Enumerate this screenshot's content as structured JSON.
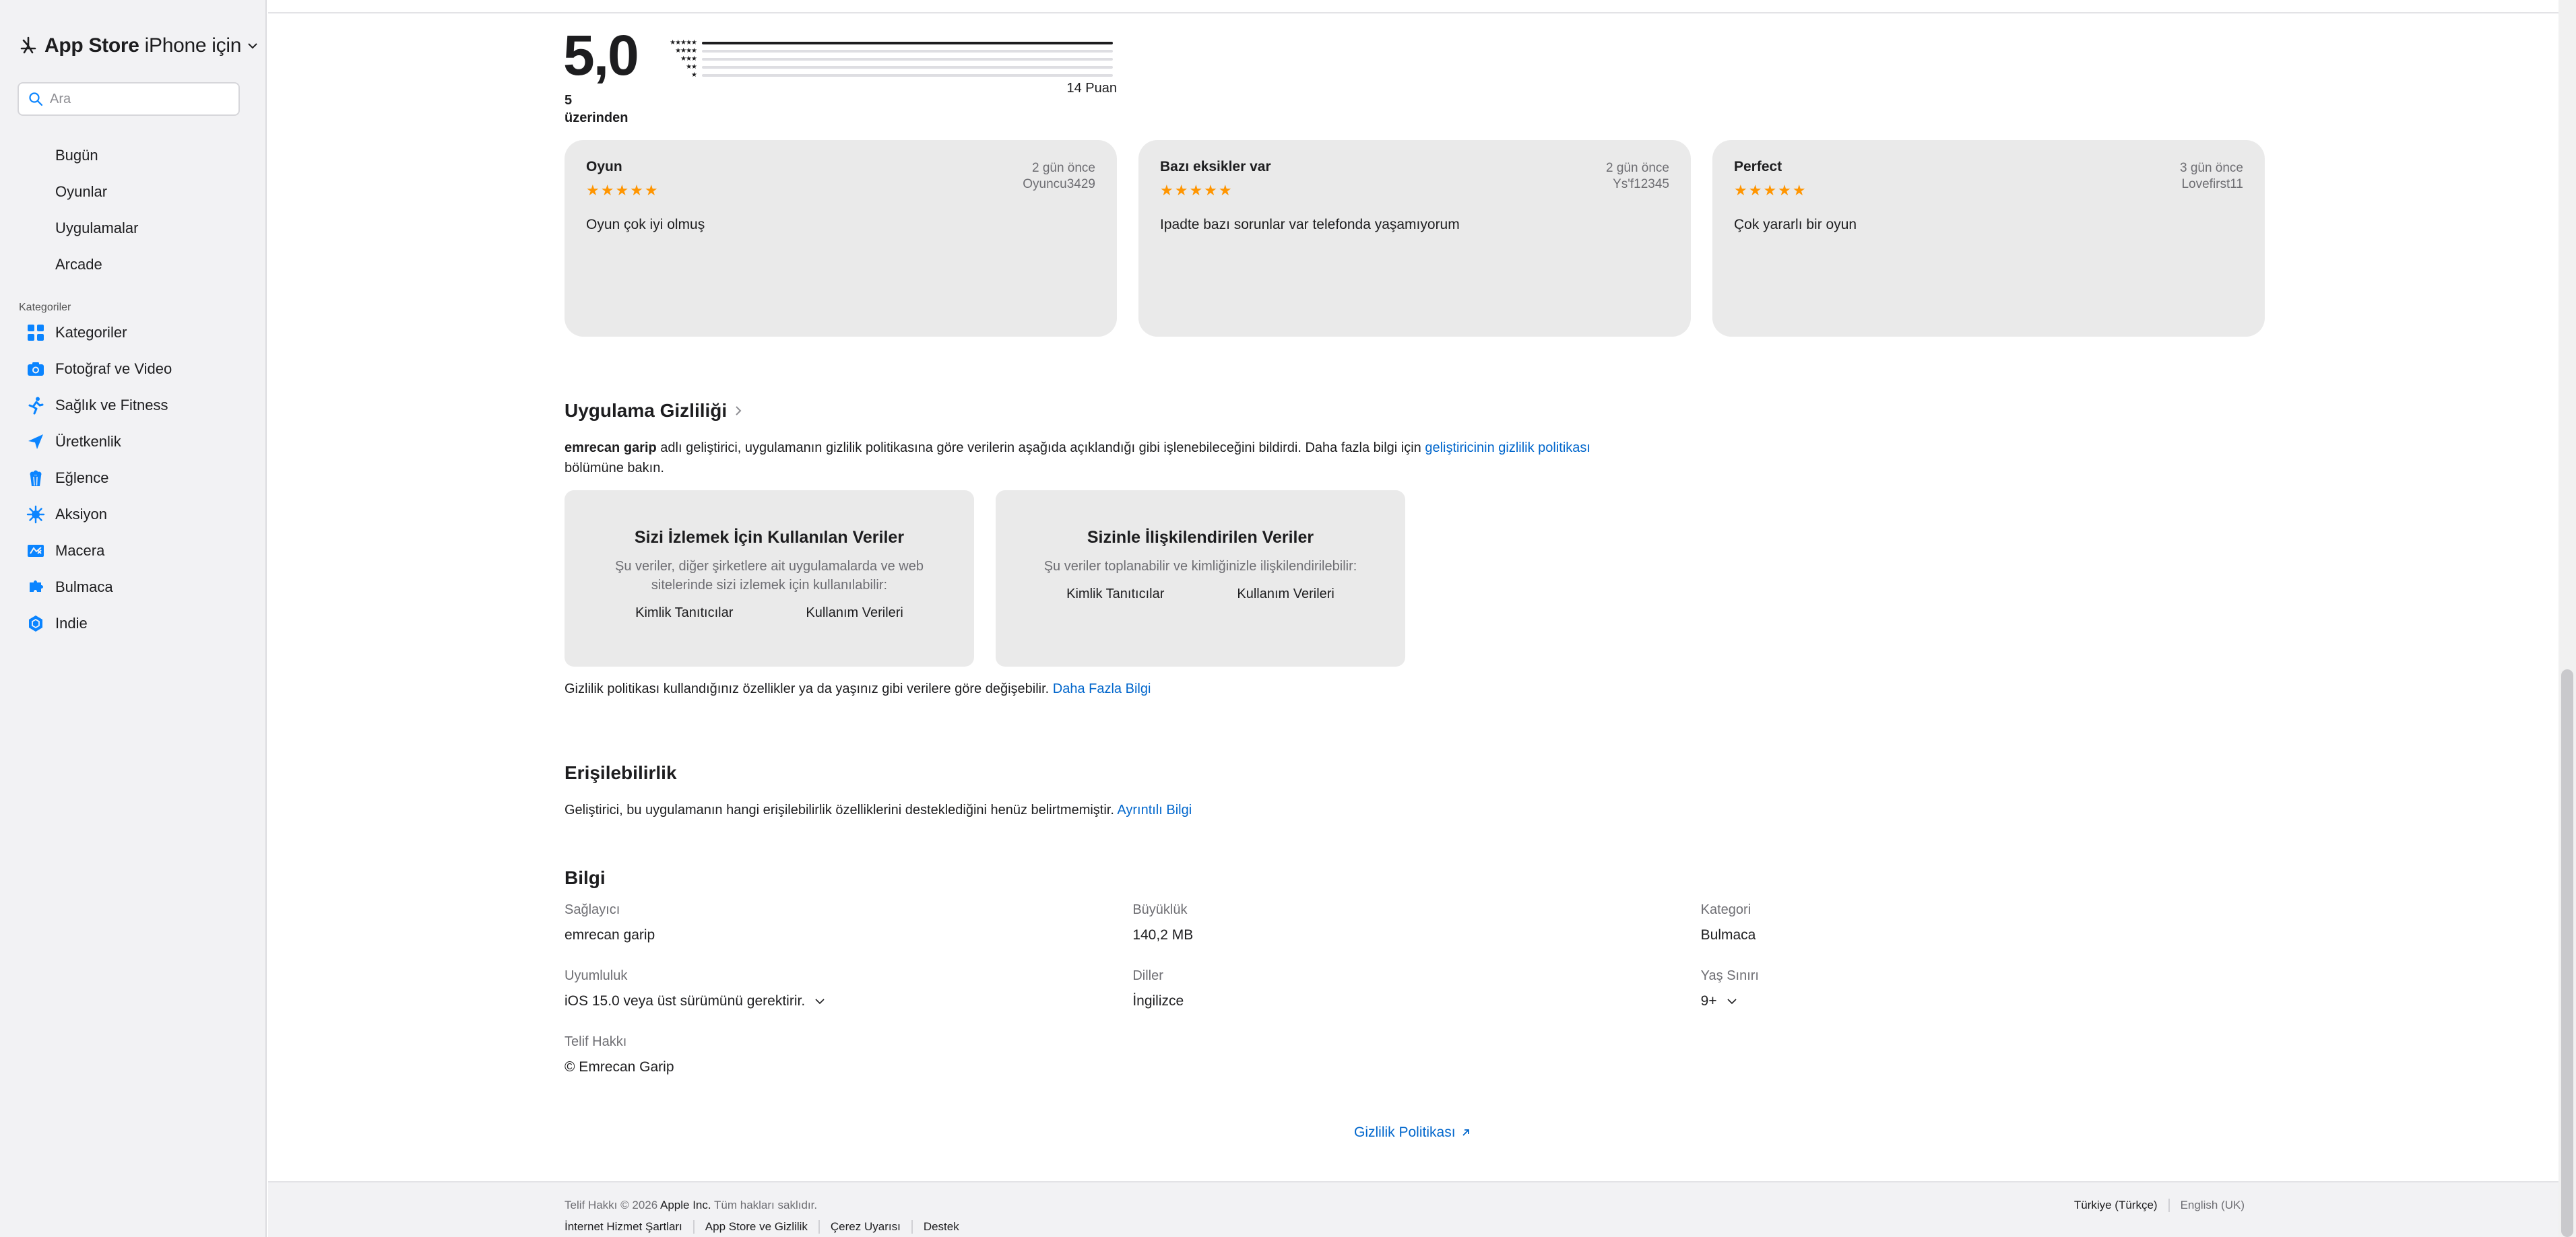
{
  "sidebar": {
    "brand": {
      "store": "App Store",
      "scope": "iPhone için"
    },
    "search_placeholder": "Ara",
    "nav": [
      "Bugün",
      "Oyunlar",
      "Uygulamalar",
      "Arcade"
    ],
    "categories_label": "Kategoriler",
    "categories": [
      {
        "label": "Kategoriler",
        "icon": "grid-icon"
      },
      {
        "label": "Fotoğraf ve Video",
        "icon": "camera-icon"
      },
      {
        "label": "Sağlık ve Fitness",
        "icon": "running-icon"
      },
      {
        "label": "Üretkenlik",
        "icon": "paper-plane-icon"
      },
      {
        "label": "Eğlence",
        "icon": "popcorn-icon"
      },
      {
        "label": "Aksiyon",
        "icon": "burst-icon"
      },
      {
        "label": "Macera",
        "icon": "map-icon"
      },
      {
        "label": "Bulmaca",
        "icon": "puzzle-icon"
      },
      {
        "label": "Indie",
        "icon": "hexagon-icon"
      }
    ],
    "accent": "#0a84ff"
  },
  "ratings": {
    "score": "5,0",
    "out_of": "5 üzerinden",
    "count": "14 Puan",
    "distribution": [
      {
        "stars": "★★★★★",
        "fraction": 1.0
      },
      {
        "stars": "★★★★",
        "fraction": 0.0
      },
      {
        "stars": "★★★",
        "fraction": 0.0
      },
      {
        "stars": "★★",
        "fraction": 0.0
      },
      {
        "stars": "★",
        "fraction": 0.0
      }
    ]
  },
  "reviews": [
    {
      "title": "Oyun",
      "stars": "★★★★★",
      "date": "2 gün önce",
      "author": "Oyuncu3429",
      "body": "Oyun çok iyi olmuş"
    },
    {
      "title": "Bazı eksikler var",
      "stars": "★★★★★",
      "date": "2 gün önce",
      "author": "Ys'f12345",
      "body": "Ipadte bazı sorunlar var telefonda yaşamıyorum"
    },
    {
      "title": "Perfect",
      "stars": "★★★★★",
      "date": "3 gün önce",
      "author": "Lovefirst11",
      "body": "Çok yararlı bir oyun"
    }
  ],
  "privacy": {
    "title": "Uygulama Gizliliği",
    "developer": "emrecan garip",
    "intro": " adlı geliştirici, uygulamanın gizlilik politikasına göre verilerin aşağıda açıklandığı gibi işlenebileceğini bildirdi. Daha fazla bilgi için ",
    "intro_link": "geliştiricinin gizlilik politikası",
    "intro_end": "bölümüne bakın.",
    "cards": [
      {
        "title": "Sizi İzlemek İçin Kullanılan Veriler",
        "desc": "Şu veriler, diğer şirketlere ait uygulamalarda ve web sitelerinde sizi izlemek için kullanılabilir:",
        "tags": [
          "Kimlik Tanıtıcılar",
          "Kullanım Verileri"
        ]
      },
      {
        "title": "Sizinle İlişkilendirilen Veriler",
        "desc": "Şu veriler toplanabilir ve kimliğinizle ilişkilendirilebilir:",
        "tags": [
          "Kimlik Tanıtıcılar",
          "Kullanım Verileri"
        ]
      }
    ],
    "note": "Gizlilik politikası kullandığınız özellikler ya da yaşınız gibi verilere göre değişebilir. ",
    "note_link": "Daha Fazla Bilgi"
  },
  "accessibility": {
    "title": "Erişilebilirlik",
    "text": "Geliştirici, bu uygulamanın hangi erişilebilirlik özelliklerini desteklediğini henüz belirtmemiştir. ",
    "link": "Ayrıntılı Bilgi"
  },
  "info": {
    "title": "Bilgi",
    "rows": [
      [
        {
          "label": "Sağlayıcı",
          "value": "emrecan garip"
        },
        {
          "label": "Büyüklük",
          "value": "140,2 MB"
        },
        {
          "label": "Kategori",
          "value": "Bulmaca"
        }
      ],
      [
        {
          "label": "Uyumluluk",
          "value": "iOS 15.0 veya üst sürümünü gerektirir."
        },
        {
          "label": "Diller",
          "value": "İngilizce"
        },
        {
          "label": "Yaş Sınırı",
          "value": "9+"
        }
      ],
      [
        {
          "label": "Telif Hakkı",
          "value": "© Emrecan Garip"
        }
      ]
    ]
  },
  "privacy_policy_link": "Gizlilik Politikası",
  "footer": {
    "copy_prefix": "Telif Hakkı © 2026 ",
    "copy_company": "Apple Inc.",
    "copy_suffix": " Tüm hakları saklıdır.",
    "links": [
      "İnternet Hizmet Şartları",
      "App Store ve Gizlilik",
      "Çerez Uyarısı",
      "Destek"
    ],
    "langs": [
      "Türkiye (Türkçe)",
      "English (UK)"
    ]
  }
}
